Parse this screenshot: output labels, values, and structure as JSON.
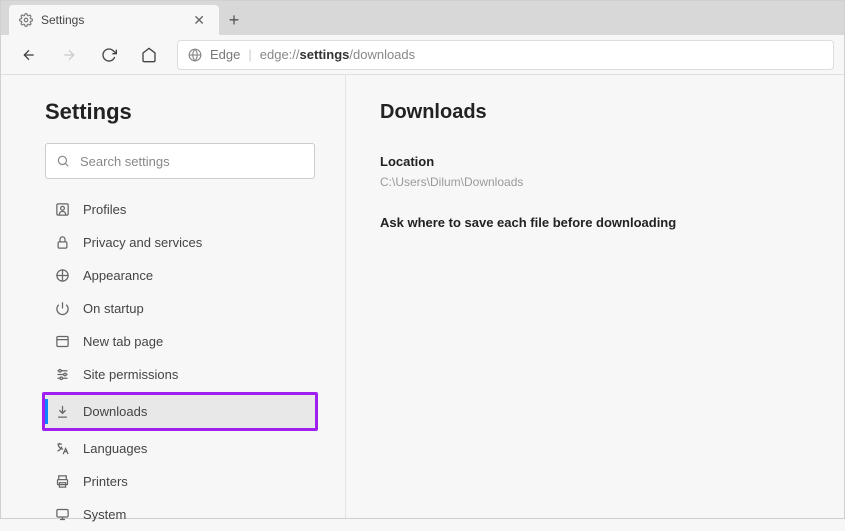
{
  "tab": {
    "title": "Settings"
  },
  "address": {
    "edge_label": "Edge",
    "url_prefix": "edge://",
    "url_bold": "settings",
    "url_suffix": "/downloads"
  },
  "sidebar": {
    "title": "Settings",
    "search_placeholder": "Search settings",
    "items": [
      {
        "label": "Profiles"
      },
      {
        "label": "Privacy and services"
      },
      {
        "label": "Appearance"
      },
      {
        "label": "On startup"
      },
      {
        "label": "New tab page"
      },
      {
        "label": "Site permissions"
      },
      {
        "label": "Downloads"
      },
      {
        "label": "Languages"
      },
      {
        "label": "Printers"
      },
      {
        "label": "System"
      }
    ]
  },
  "panel": {
    "title": "Downloads",
    "location_label": "Location",
    "location_path": "C:\\Users\\Dilum\\Downloads",
    "ask_label": "Ask where to save each file before downloading"
  }
}
